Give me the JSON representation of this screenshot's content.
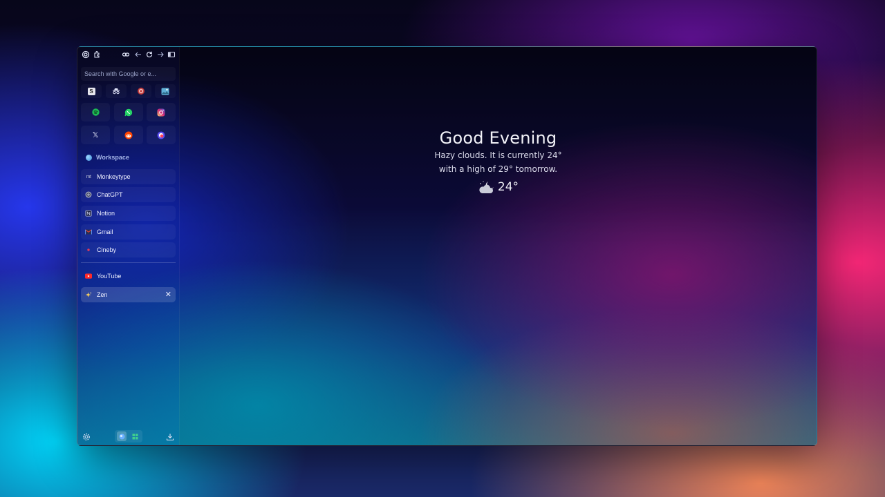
{
  "sidebar": {
    "toolbar": {
      "icons": [
        "settings-icon",
        "extension-icon",
        "link-icon",
        "back-icon",
        "reload-icon",
        "forward-icon",
        "sidebar-toggle-icon"
      ]
    },
    "search": {
      "placeholder": "Search with Google or e..."
    },
    "small_pins": [
      {
        "icon": "scratchpad-icon",
        "letter": "S"
      },
      {
        "icon": "incognito-icon"
      },
      {
        "icon": "target-icon"
      },
      {
        "icon": "image-gallery-icon"
      }
    ],
    "large_pins": [
      {
        "icon": "spotify-icon"
      },
      {
        "icon": "whatsapp-icon"
      },
      {
        "icon": "instagram-icon"
      },
      {
        "icon": "x-icon",
        "letter": "𝕏"
      },
      {
        "icon": "reddit-icon"
      },
      {
        "icon": "firefox-relay-icon"
      }
    ],
    "workspace": {
      "label": "Workspace"
    },
    "tabs": [
      {
        "label": "Monkeytype",
        "fav": "mt"
      },
      {
        "label": "ChatGPT"
      },
      {
        "label": "Notion"
      },
      {
        "label": "Gmail"
      },
      {
        "label": "Cineby"
      }
    ],
    "open_tabs": [
      {
        "label": "YouTube"
      },
      {
        "label": "Zen",
        "active": true
      }
    ],
    "bottom": {
      "icons": [
        "settings-icon",
        "workspace-switcher-icon",
        "download-icon"
      ]
    }
  },
  "newtab": {
    "greeting": "Good Evening",
    "weather_line1": "Hazy clouds. It is currently 24°",
    "weather_line2": "with a high of 29° tomorrow.",
    "temperature": "24°",
    "weather_icon": "partly-cloudy-night-icon"
  },
  "colors": {
    "accent": "#3a8ad8",
    "youtube": "#ff2a2a",
    "whatsapp": "#25d366",
    "spotify": "#1db954",
    "instagram": "#e1306c",
    "reddit": "#ff4500"
  }
}
